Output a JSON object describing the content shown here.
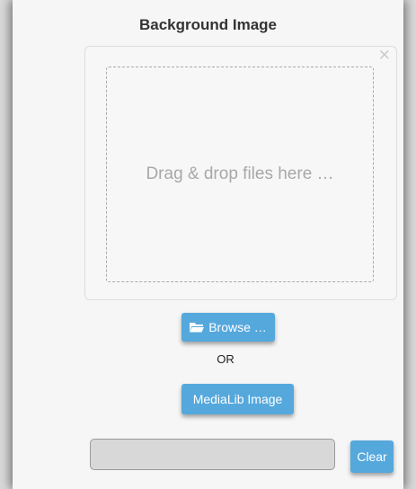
{
  "panel": {
    "title": "Background Image"
  },
  "drop_zone": {
    "close_glyph": "×",
    "placeholder": "Drag & drop files here …"
  },
  "buttons": {
    "browse_label": "Browse …",
    "browse_icon": "folder-open-icon",
    "or_label": "OR",
    "medialib_label": "MediaLib Image",
    "clear_label": "Clear"
  },
  "url_field": {
    "value": ""
  },
  "colors": {
    "button_blue": "#55a8dc",
    "panel_background": "#f6f6f6",
    "input_background": "#d8d8d8"
  }
}
